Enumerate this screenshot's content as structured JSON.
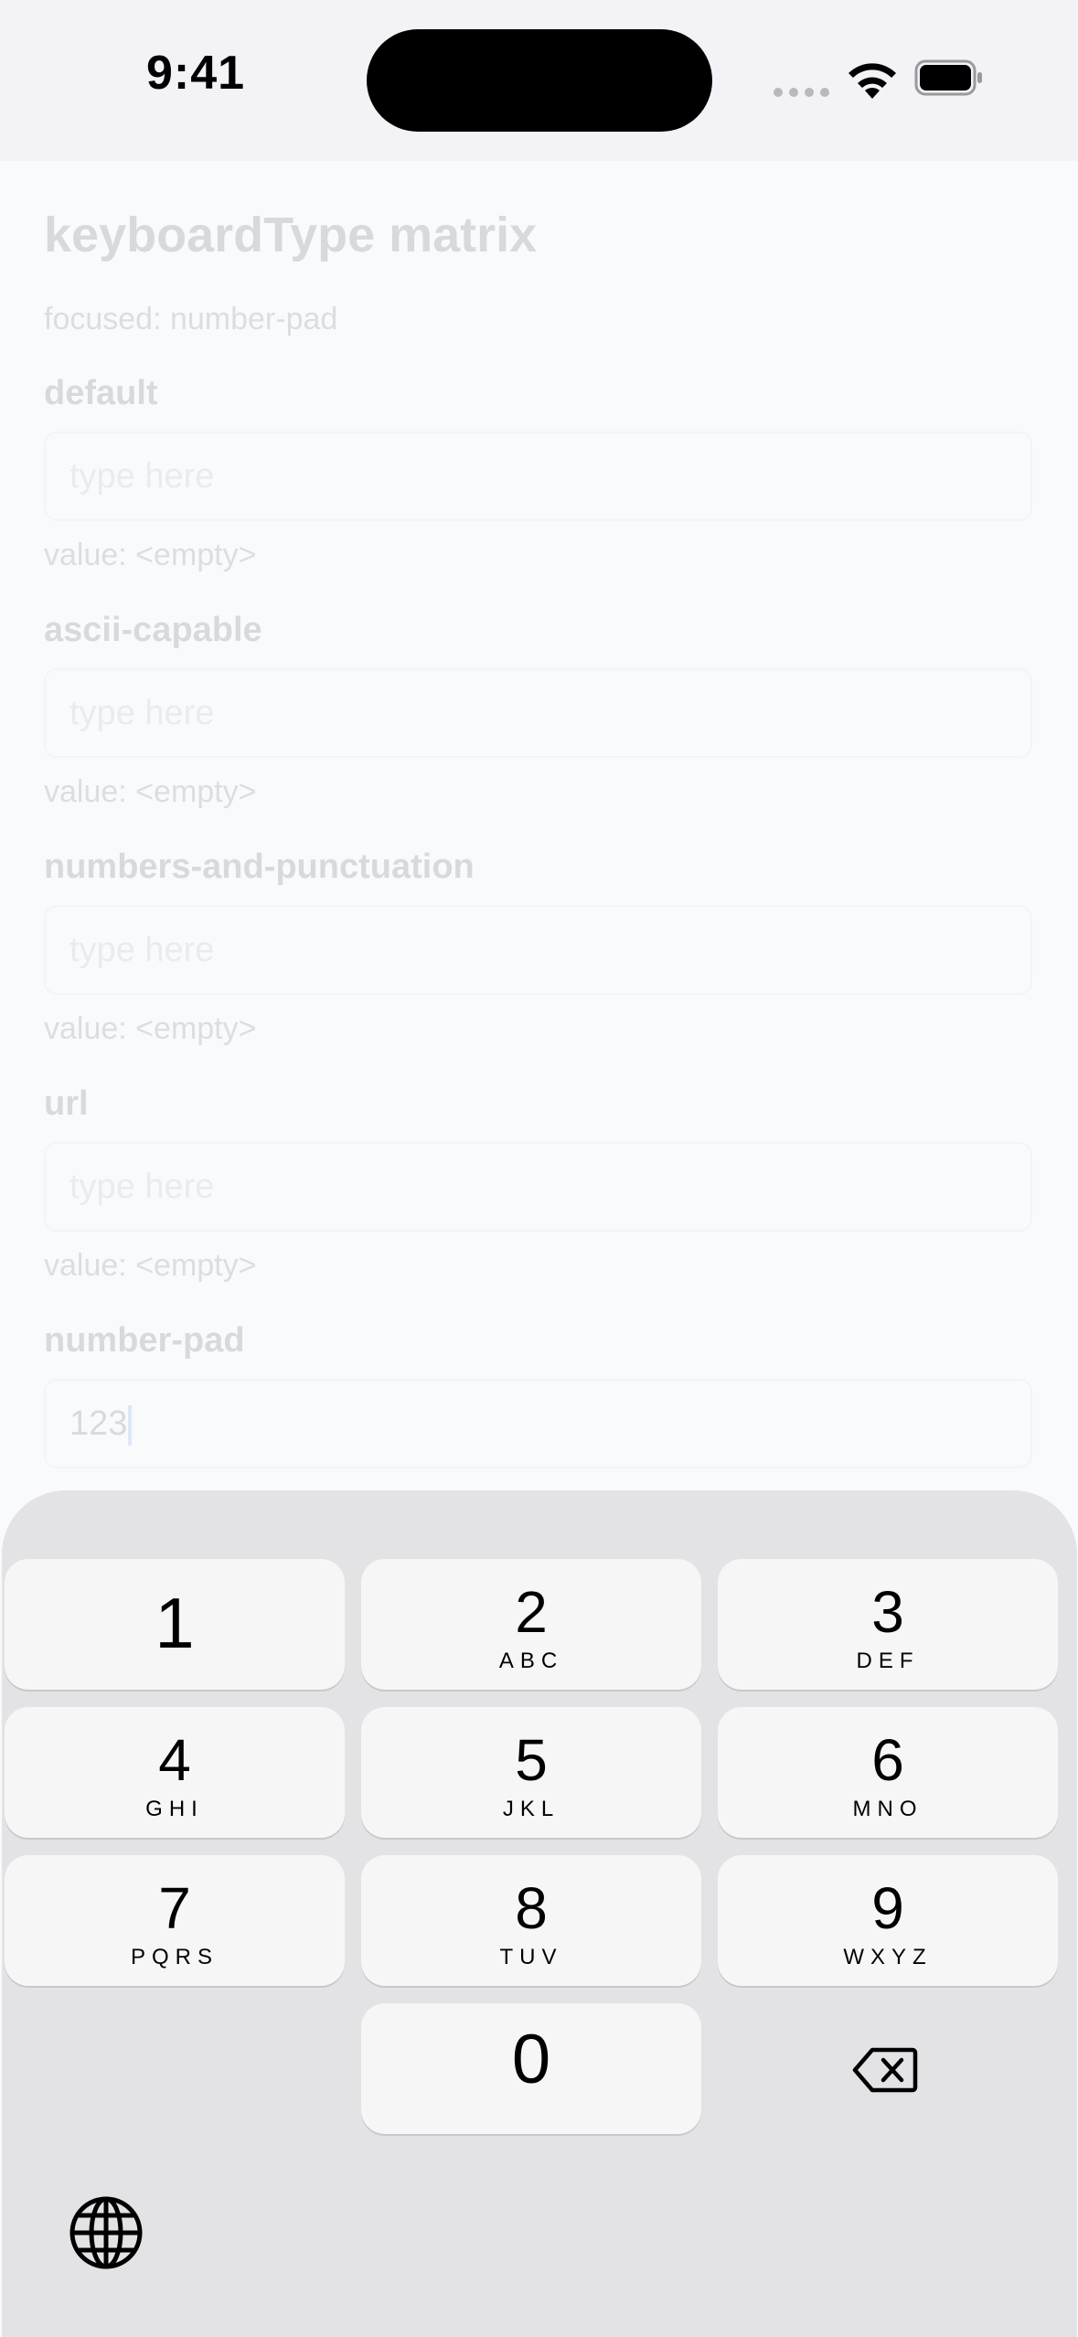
{
  "status_bar": {
    "time": "9:41"
  },
  "screen": {
    "title": "keyboardType matrix",
    "focused_line": "focused: number-pad",
    "fields": [
      {
        "label": "default",
        "placeholder": "type here",
        "value_line": "value: <empty>"
      },
      {
        "label": "ascii-capable",
        "placeholder": "type here",
        "value_line": "value: <empty>"
      },
      {
        "label": "numbers-and-punctuation",
        "placeholder": "type here",
        "value_line": "value: <empty>"
      },
      {
        "label": "url",
        "placeholder": "type here",
        "value_line": "value: <empty>"
      },
      {
        "label": "number-pad",
        "value": "123"
      }
    ]
  },
  "keyboard": {
    "keys": [
      {
        "num": "1",
        "letters": ""
      },
      {
        "num": "2",
        "letters": "ABC"
      },
      {
        "num": "3",
        "letters": "DEF"
      },
      {
        "num": "4",
        "letters": "GHI"
      },
      {
        "num": "5",
        "letters": "JKL"
      },
      {
        "num": "6",
        "letters": "MNO"
      },
      {
        "num": "7",
        "letters": "PQRS"
      },
      {
        "num": "8",
        "letters": "TUV"
      },
      {
        "num": "9",
        "letters": "WXYZ"
      },
      {
        "num": "0",
        "letters": ""
      }
    ],
    "icons": {
      "delete": "delete-backspace-icon",
      "globe": "globe-icon"
    }
  }
}
